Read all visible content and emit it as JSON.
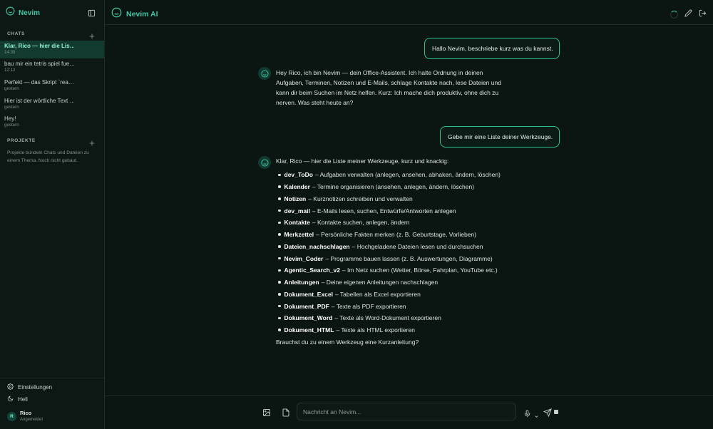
{
  "sidebar": {
    "brand": "Nevim",
    "chats_heading": "CHATS",
    "chats": [
      {
        "title": "Klar, Rico — hier die Lis…",
        "time": "14:30",
        "active": true
      },
      {
        "title": "bau mir ein tetris spiel fue…",
        "time": "12:12",
        "active": false
      },
      {
        "title": "Perfekt — das Skript `rea…",
        "time": "gestern",
        "active": false
      },
      {
        "title": "Hier ist der wörtliche Text …",
        "time": "gestern",
        "active": false
      },
      {
        "title": "Hey!",
        "time": "gestern",
        "active": false
      }
    ],
    "projects_heading": "PROJEKTE",
    "projects_hint": "Projekte bündeln Chats und Dateien zu einem Thema. Noch nicht gebaut.",
    "settings_label": "Einstellungen",
    "theme_label": "Hell",
    "user": {
      "initial": "R",
      "name": "Rico",
      "status": "Angemeldet"
    }
  },
  "header": {
    "title": "Nevim AI"
  },
  "conversation": {
    "user_msg_1": "Hallo Nevim, beschriebe kurz was du kannst.",
    "bot_msg_1": [
      "Hey Rico, ich bin Nevim — dein Office-Assistent. Ich halte Ordnung in deinen",
      "Aufgaben, Terminen, Notizen und E-Mails, schlage Kontakte nach, lese Dateien und",
      "kann dir beim Suchen im Netz helfen. Kurz: Ich mache dich produktiv, ohne dich zu",
      "nerven. Was steht heute an?"
    ],
    "user_msg_2": "Gebe mir eine Liste deiner Werkzeuge.",
    "bot_msg_2_intro": "Klar, Rico — hier die Liste meiner Werkzeuge, kurz und knackig:",
    "tools": [
      {
        "name": "dev_ToDo",
        "desc": "– Aufgaben verwalten (anlegen, ansehen, abhaken, ändern, löschen)"
      },
      {
        "name": "Kalender",
        "desc": "– Termine organisieren (ansehen, anlegen, ändern, löschen)"
      },
      {
        "name": "Notizen",
        "desc": "– Kurznotizen schreiben und verwalten"
      },
      {
        "name": "dev_mail",
        "desc": "– E-Mails lesen, suchen, Entwürfe/Antworten anlegen"
      },
      {
        "name": "Kontakte",
        "desc": "– Kontakte suchen, anlegen, ändern"
      },
      {
        "name": "Merkzettel",
        "desc": "– Persönliche Fakten merken (z. B. Geburtstage, Vorlieben)"
      },
      {
        "name": "Dateien_nachschlagen",
        "desc": "– Hochgeladene Dateien lesen und durchsuchen"
      },
      {
        "name": "Nevim_Coder",
        "desc": "– Programme bauen lassen (z. B. Auswertungen, Diagramme)"
      },
      {
        "name": "Agentic_Search_v2",
        "desc": "– Im Netz suchen (Wetter, Börse, Fahrplan, YouTube etc.)"
      },
      {
        "name": "Anleitungen",
        "desc": "– Deine eigenen Anleitungen nachschlagen"
      },
      {
        "name": "Dokument_Excel",
        "desc": "– Tabellen als Excel exportieren"
      },
      {
        "name": "Dokument_PDF",
        "desc": "– Texte als PDF exportieren"
      },
      {
        "name": "Dokument_Word",
        "desc": "– Texte als Word-Dokument exportieren"
      },
      {
        "name": "Dokument_HTML",
        "desc": "– Texte als HTML exportieren"
      }
    ],
    "bot_msg_2_outro": "Brauchst du zu einem Werkzeug eine Kurzanleitung?"
  },
  "composer": {
    "placeholder": "Nachricht an Nevim..."
  },
  "colors": {
    "accent": "#3fc9a6",
    "background": "#0b1512",
    "sidebar": "#0d1714",
    "active_chat": "#123a31"
  }
}
